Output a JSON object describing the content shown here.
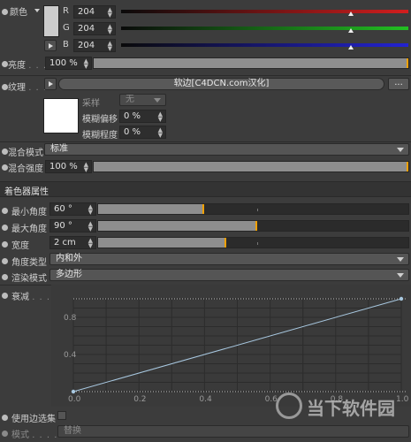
{
  "color": {
    "label": "颜色",
    "channels": [
      {
        "name": "R",
        "value": "204",
        "color": "#d21e1e"
      },
      {
        "name": "G",
        "value": "204",
        "color": "#22c022"
      },
      {
        "name": "B",
        "value": "204",
        "color": "#2323d2"
      }
    ],
    "swatch": "#cccccc"
  },
  "brightness": {
    "label": "亮度",
    "value": "100 %",
    "level": 1.0
  },
  "texture": {
    "label": "纹理",
    "button_text": "软边[C4DCN.com汉化]",
    "more_button": "...",
    "sampling_label": "采样",
    "sampling_value": "无",
    "blur_offset_label": "模糊偏移",
    "blur_offset_value": "0 %",
    "blur_scale_label": "模糊程度",
    "blur_scale_value": "0 %"
  },
  "mix_mode": {
    "label": "混合模式",
    "value": "标准"
  },
  "mix_strength": {
    "label": "混合强度",
    "value": "100 %",
    "level": 1.0
  },
  "section_title": "着色器属性",
  "min_angle": {
    "label": "最小角度",
    "value": "60 °",
    "level": 0.34
  },
  "max_angle": {
    "label": "最大角度",
    "value": "90 °",
    "level": 0.51
  },
  "width": {
    "label": "宽度",
    "value": "2 cm",
    "level": 0.41
  },
  "angle_type": {
    "label": "角度类型",
    "value": "内和外"
  },
  "render_mode": {
    "label": "渲染模式",
    "value": "多边形"
  },
  "falloff": {
    "label": "衰减",
    "y_ticks": [
      "0.8",
      "0.4"
    ],
    "x_ticks": [
      "0.0",
      "0.2",
      "0.4",
      "0.6",
      "0.8",
      "1.0"
    ]
  },
  "chart_data": {
    "type": "line",
    "x": [
      0.0,
      1.0
    ],
    "y": [
      0.0,
      1.0
    ],
    "xlim": [
      0,
      1
    ],
    "ylim": [
      0,
      1
    ],
    "grid": true
  },
  "use_edge_selection": {
    "label": "使用边选集"
  },
  "mode": {
    "label": "模式",
    "value": "替换"
  },
  "watermark": "当下软件园"
}
